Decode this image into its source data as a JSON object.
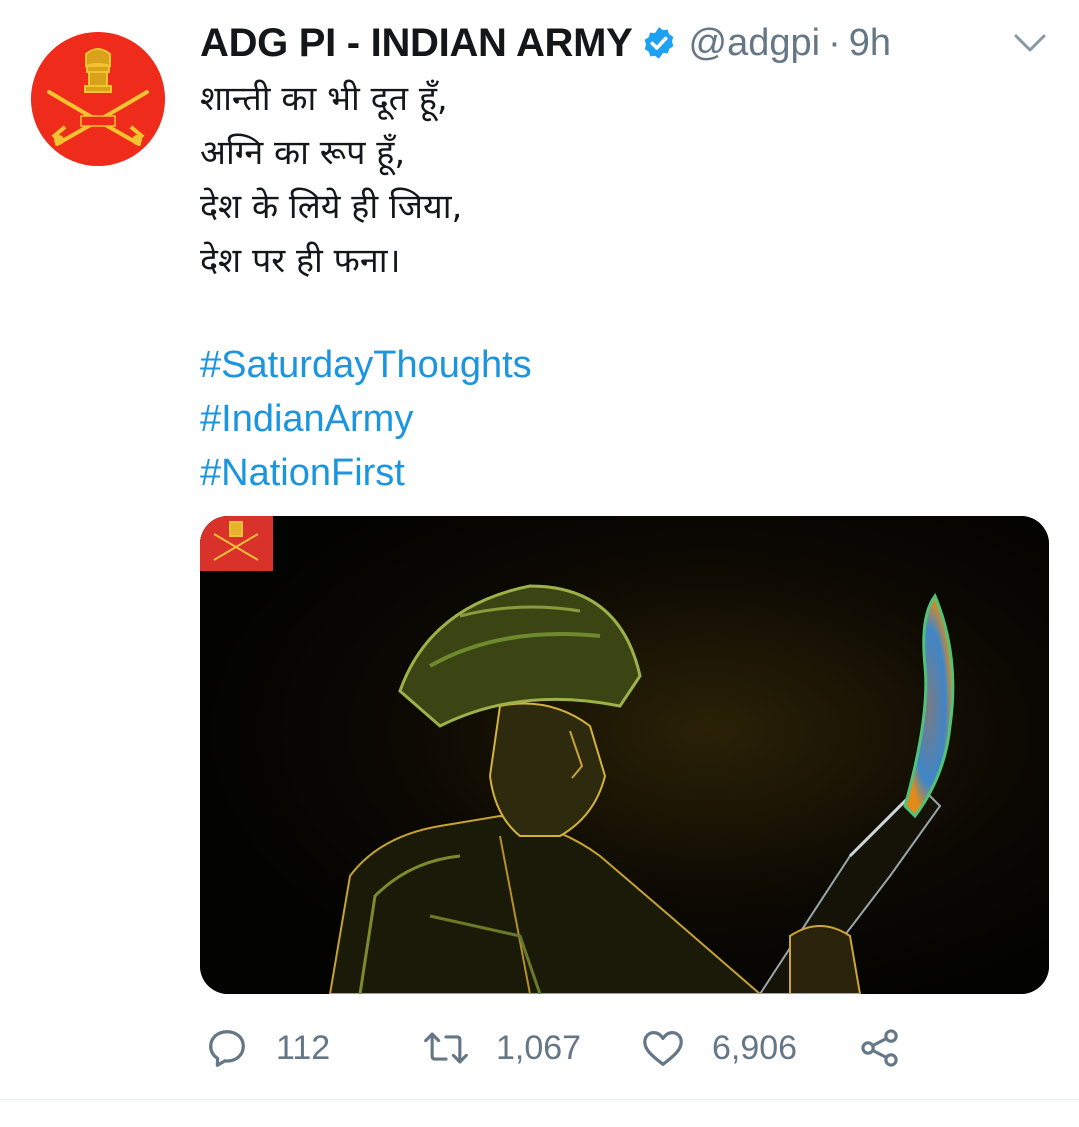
{
  "tweet": {
    "author": {
      "display_name": "ADG PI - INDIAN ARMY",
      "handle": "@adgpi",
      "verified": true,
      "avatar_icon": "indian-army-emblem",
      "avatar_color": "#ef2b1c"
    },
    "separator": "·",
    "time": "9h",
    "menu_icon": "chevron-down-icon",
    "text_lines": [
      "शान्ती का भी दूत हूँ,",
      "अग्नि का रूप हूँ,",
      "देश के लिये ही जिया,",
      "देश पर ही फना।"
    ],
    "hashtags": [
      "#SaturdayThoughts",
      "#IndianArmy",
      "#NationFirst"
    ],
    "media": {
      "description_icon": "soldier-with-flaming-rifle-image",
      "badge_icon": "indian-army-emblem"
    },
    "actions": {
      "reply": {
        "icon": "reply-icon",
        "count": "112"
      },
      "retweet": {
        "icon": "retweet-icon",
        "count": "1,067"
      },
      "like": {
        "icon": "heart-icon",
        "count": "6,906"
      },
      "share": {
        "icon": "share-icon"
      }
    }
  },
  "colors": {
    "text": "#14171a",
    "secondary": "#657786",
    "link": "#1b95e0",
    "verified": "#1da1f2",
    "divider": "#e6ecf0"
  }
}
